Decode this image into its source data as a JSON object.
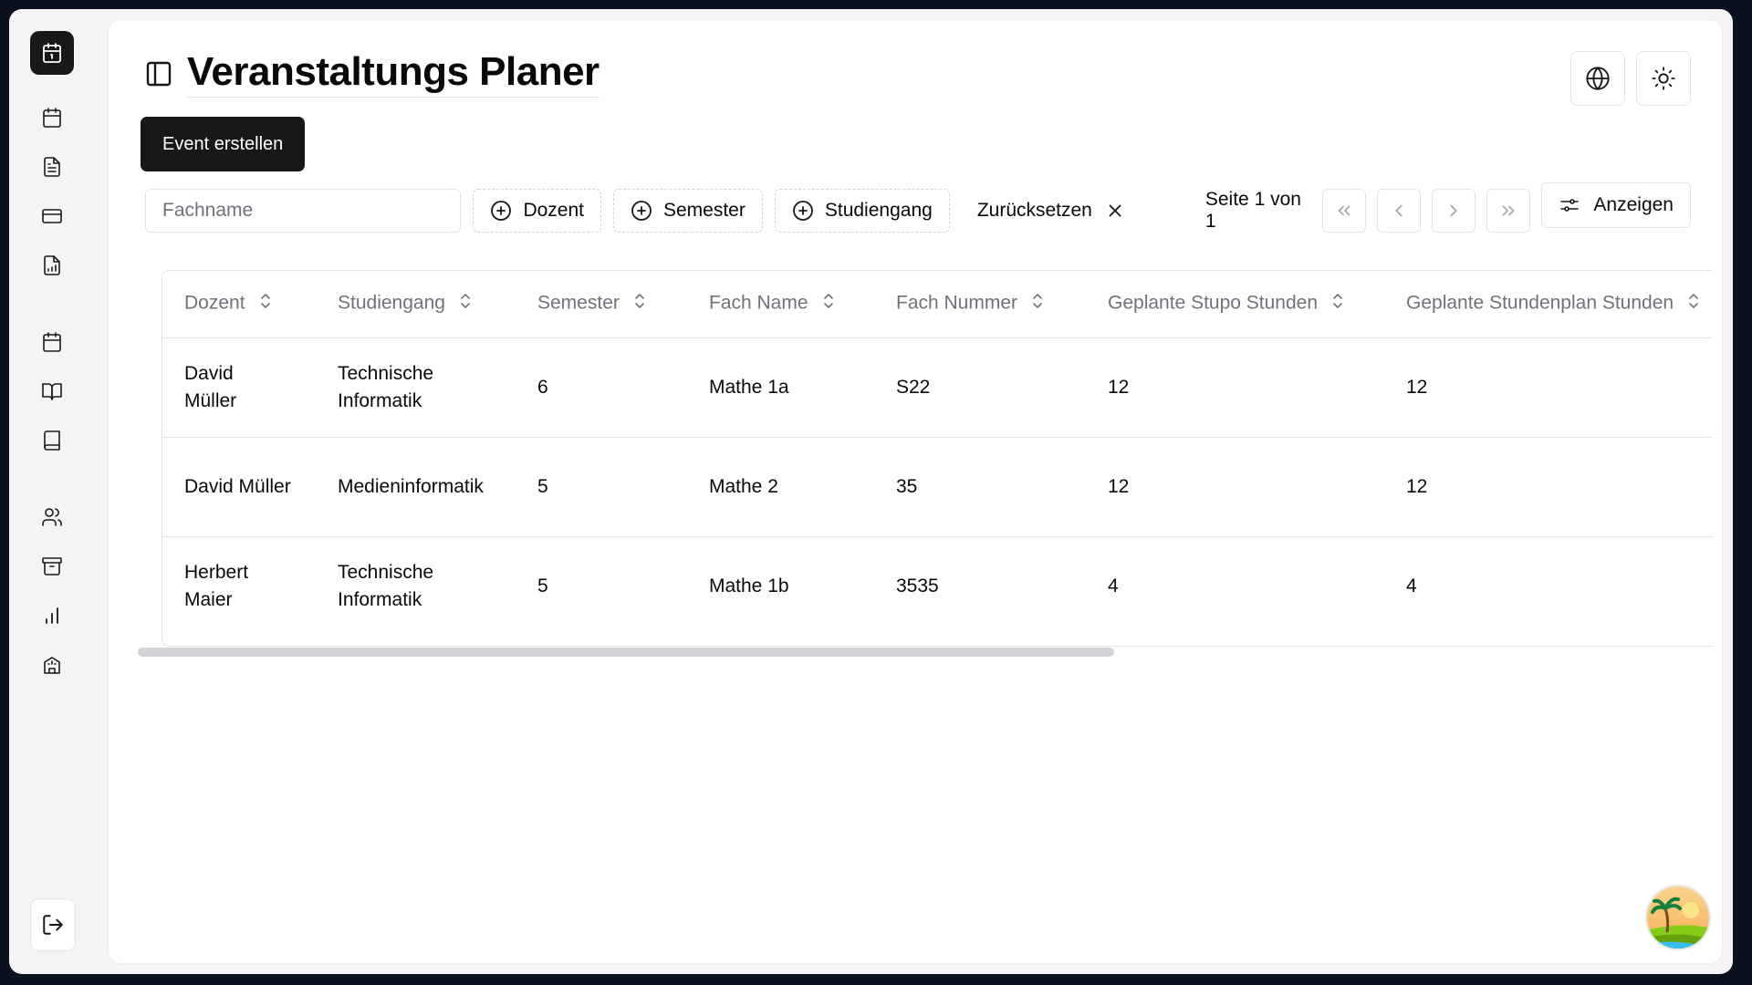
{
  "app": {
    "title": "Veranstaltungs Planer",
    "create_label": "Event erstellen"
  },
  "sidebar": {
    "icons": [
      "calendar-icon",
      "file-text-icon",
      "credit-card-icon",
      "file-chart-icon",
      "calendar-icon",
      "book-open-icon",
      "book-icon",
      "users-icon",
      "archive-icon",
      "bar-chart-icon",
      "building-icon"
    ],
    "logout": "logout-icon"
  },
  "toolbar": {
    "search_placeholder": "Fachname",
    "filters": [
      "Dozent",
      "Semester",
      "Studiengang"
    ],
    "reset_label": "Zurücksetzen",
    "page_info": "Seite 1 von 1",
    "view_label": "Anzeigen"
  },
  "table": {
    "headers": [
      "Dozent",
      "Studiengang",
      "Semester",
      "Fach Name",
      "Fach Nummer",
      "Geplante Stupo Stunden",
      "Geplante Stundenplan Stunden"
    ],
    "rows": [
      [
        "David Müller",
        "Technische Informatik",
        "6",
        "Mathe 1a",
        "S22",
        "12",
        "12"
      ],
      [
        "David Müller",
        "Medieninformatik",
        "5",
        "Mathe 2",
        "35",
        "12",
        "12"
      ],
      [
        "Herbert Maier",
        "Technische Informatik",
        "5",
        "Mathe 1b",
        "3535",
        "4",
        "4"
      ]
    ]
  },
  "colors": {
    "primary": "#18181b",
    "border": "#e4e4e7",
    "muted_text": "#71717a",
    "outer_bg": "#0b1120"
  }
}
